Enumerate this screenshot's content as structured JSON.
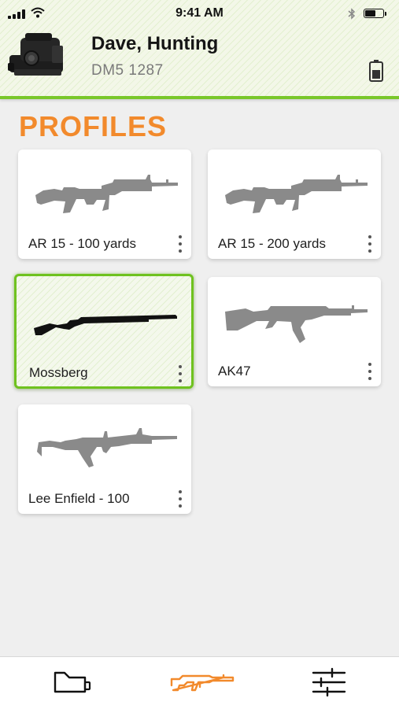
{
  "status_bar": {
    "time": "9:41 AM"
  },
  "header": {
    "device_name": "Dave, Hunting",
    "device_id": "DM5 1287",
    "device_icon": "red-dot-sight-image",
    "battery_icon": "device-battery-icon"
  },
  "section": {
    "title": "PROFILES"
  },
  "profiles": [
    {
      "label": "AR 15  - 100 yards",
      "icon": "ar15-rifle-icon",
      "selected": false
    },
    {
      "label": "AR 15 - 200 yards",
      "icon": "ar15-rifle-icon",
      "selected": false
    },
    {
      "label": "Mossberg",
      "icon": "shotgun-icon",
      "selected": true
    },
    {
      "label": "AK47",
      "icon": "ak47-rifle-icon",
      "selected": false
    },
    {
      "label": "Lee Enfield - 100",
      "icon": "carbine-rifle-icon",
      "selected": false
    }
  ],
  "tabbar": {
    "tabs": [
      {
        "name": "devices",
        "icon": "device-icon",
        "active": false
      },
      {
        "name": "profiles",
        "icon": "rifle-icon",
        "active": true
      },
      {
        "name": "settings",
        "icon": "sliders-icon",
        "active": false
      }
    ]
  },
  "colors": {
    "accent_orange": "#f28a2c",
    "accent_green": "#79c72a",
    "gun_gray": "#8a8a8a",
    "gun_selected": "#111111"
  }
}
